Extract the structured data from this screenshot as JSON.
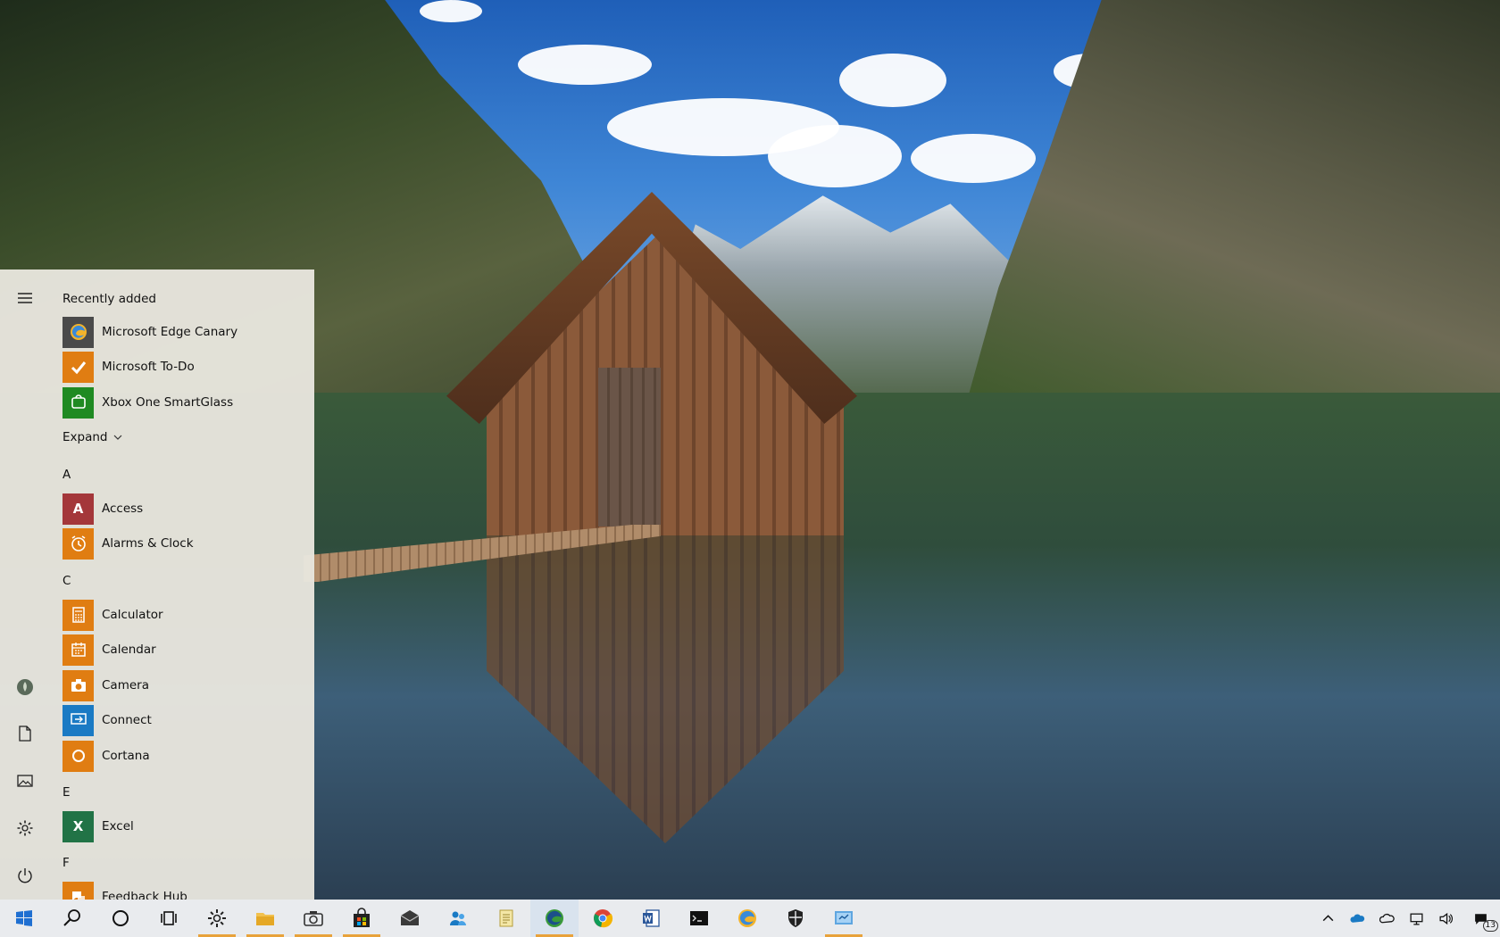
{
  "start_menu": {
    "recently_added_header": "Recently added",
    "recently_added": [
      {
        "label": "Microsoft Edge Canary",
        "icon": "edge-canary-icon",
        "color": "#4a4a4a"
      },
      {
        "label": "Microsoft To-Do",
        "icon": "todo-check-icon",
        "color": "#e07d12"
      },
      {
        "label": "Xbox One SmartGlass",
        "icon": "smartglass-icon",
        "color": "#1f8a22"
      }
    ],
    "expand_label": "Expand",
    "groups": [
      {
        "letter": "A",
        "apps": [
          {
            "label": "Access",
            "icon": "access-icon",
            "glyph": "A",
            "color": "#a4373a"
          },
          {
            "label": "Alarms & Clock",
            "icon": "alarm-clock-icon",
            "color": "#e07d12"
          }
        ]
      },
      {
        "letter": "C",
        "apps": [
          {
            "label": "Calculator",
            "icon": "calculator-icon",
            "color": "#e07d12"
          },
          {
            "label": "Calendar",
            "icon": "calendar-icon",
            "color": "#e07d12"
          },
          {
            "label": "Camera",
            "icon": "camera-icon",
            "color": "#e07d12"
          },
          {
            "label": "Connect",
            "icon": "connect-icon",
            "color": "#1a7ac4"
          },
          {
            "label": "Cortana",
            "icon": "cortana-icon",
            "color": "#e07d12"
          }
        ]
      },
      {
        "letter": "E",
        "apps": [
          {
            "label": "Excel",
            "icon": "excel-icon",
            "glyph": "X",
            "color": "#217346"
          }
        ]
      },
      {
        "letter": "F",
        "apps": [
          {
            "label": "Feedback Hub",
            "icon": "feedback-hub-icon",
            "color": "#e07d12"
          }
        ]
      }
    ]
  },
  "taskbar": {
    "apps": [
      {
        "name": "start-button",
        "icon": "windows-logo-icon"
      },
      {
        "name": "search-button",
        "icon": "search-icon"
      },
      {
        "name": "cortana-button",
        "icon": "cortana-ring-icon"
      },
      {
        "name": "task-view-button",
        "icon": "task-view-icon"
      },
      {
        "name": "settings-button",
        "icon": "gear-icon",
        "pinned": true
      },
      {
        "name": "file-explorer-button",
        "icon": "folder-icon",
        "pinned": true
      },
      {
        "name": "camera-button",
        "icon": "camera-icon",
        "pinned": true
      },
      {
        "name": "store-button",
        "icon": "store-bag-icon",
        "pinned": true
      },
      {
        "name": "mail-button",
        "icon": "mail-icon"
      },
      {
        "name": "feedback-button",
        "icon": "people-icon"
      },
      {
        "name": "notepad-button",
        "icon": "notepad-icon"
      },
      {
        "name": "edge-dev-button",
        "icon": "edge-dev-icon",
        "pinned": true,
        "active": true
      },
      {
        "name": "chrome-button",
        "icon": "chrome-icon"
      },
      {
        "name": "word-button",
        "icon": "word-icon"
      },
      {
        "name": "terminal-button",
        "icon": "terminal-icon"
      },
      {
        "name": "edge-canary-button",
        "icon": "edge-canary-icon"
      },
      {
        "name": "defender-button",
        "icon": "shield-icon"
      },
      {
        "name": "remote-desktop-button",
        "icon": "remote-desktop-icon",
        "pinned": true
      }
    ],
    "tray": {
      "notification_count": "13"
    }
  }
}
